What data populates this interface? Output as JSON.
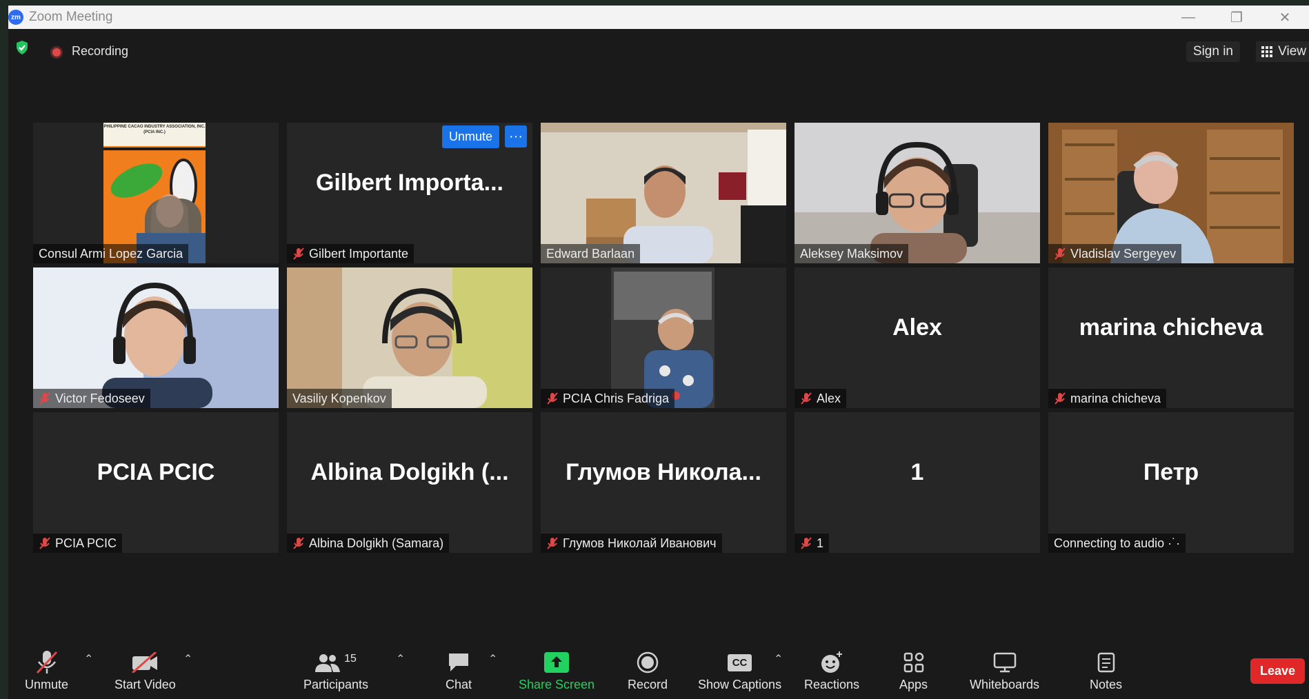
{
  "window": {
    "title": "Zoom Meeting",
    "app_icon": "zm"
  },
  "topbar": {
    "recording_label": "Recording",
    "signin_label": "Sign in",
    "view_label": "View"
  },
  "tiles": [
    {
      "id": "t1",
      "big": "",
      "name": "Consul Armi Lopez Garcia",
      "muted": false,
      "video": "cacao-logo",
      "poster_text": "PHILIPPINE CACAO INDUSTRY ASSOCIATION, INC. (PCIA INC.)"
    },
    {
      "id": "t2",
      "big": "Gilbert  Importa...",
      "name": "Gilbert Importante",
      "muted": true,
      "unmute_label": "Unmute",
      "more_label": "···"
    },
    {
      "id": "t3",
      "big": "",
      "name": "Edward Barlaan",
      "muted": false,
      "video": "man-room"
    },
    {
      "id": "t4",
      "big": "",
      "name": "Aleksey Maksimov",
      "muted": false,
      "video": "headset",
      "active": true
    },
    {
      "id": "t5",
      "big": "",
      "name": "Vladislav Sergeyev",
      "muted": true,
      "video": "bookshelf"
    },
    {
      "id": "t6",
      "big": "",
      "name": "Victor Fedoseev",
      "muted": true,
      "video": "headset-blue"
    },
    {
      "id": "t7",
      "big": "",
      "name": "Vasiliy Kopenkov",
      "muted": false,
      "video": "glasses"
    },
    {
      "id": "t8",
      "big": "",
      "name": "PCIA Chris Fadriga",
      "muted": true,
      "video": "car"
    },
    {
      "id": "t9",
      "big": "Alex",
      "name": "Alex",
      "muted": true
    },
    {
      "id": "t10",
      "big": "marina chicheva",
      "name": "marina chicheva",
      "muted": true
    },
    {
      "id": "t11",
      "big": "PCIA PCIC",
      "name": "PCIA PCIC",
      "muted": true
    },
    {
      "id": "t12",
      "big": "Albina  Dolgikh  (...",
      "name": "Albina Dolgikh (Samara)",
      "muted": true
    },
    {
      "id": "t13",
      "big": "Глумов  Никола...",
      "name": "Глумов Николай Иванович",
      "muted": true
    },
    {
      "id": "t14",
      "big": "1",
      "name": "1",
      "muted": true
    },
    {
      "id": "t15",
      "big": "Петр",
      "name": "Connecting to audio ·˙·",
      "muted": false
    }
  ],
  "toolbar": {
    "unmute": "Unmute",
    "start_video": "Start Video",
    "participants": "Participants",
    "participants_count": "15",
    "chat": "Chat",
    "share_screen": "Share Screen",
    "record": "Record",
    "show_captions": "Show Captions",
    "captions_badge": "CC",
    "reactions": "Reactions",
    "apps": "Apps",
    "whiteboards": "Whiteboards",
    "notes": "Notes",
    "leave": "Leave"
  },
  "colors": {
    "active_speaker": "#c8e04a",
    "share_green": "#23d160",
    "leave_red": "#e02828",
    "unmute_blue": "#1a73e8"
  }
}
